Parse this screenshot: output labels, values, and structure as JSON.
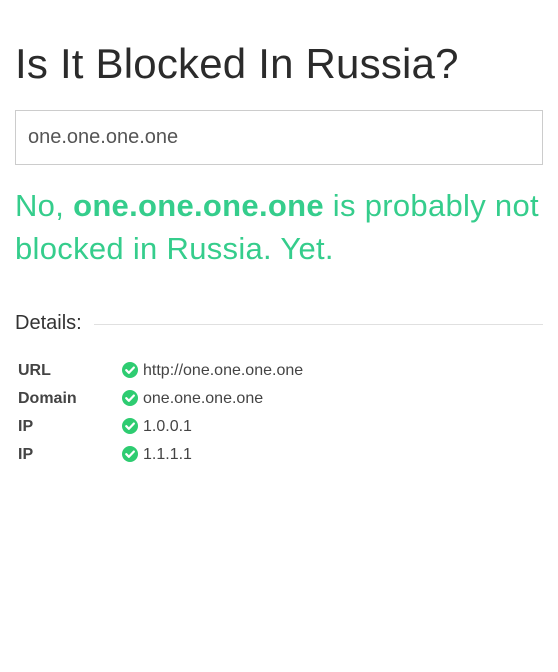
{
  "header": {
    "title": "Is It Blocked In Russia?"
  },
  "search": {
    "value": "one.one.one.one"
  },
  "result": {
    "prefix": "No,",
    "domain": "one.one.one.one",
    "suffix": "is probably not blocked in Russia. Yet.",
    "color": "#35cd8c"
  },
  "details": {
    "label": "Details:",
    "status_icon": "check-circle-icon",
    "status_color": "#2ecc71",
    "rows": [
      {
        "key": "URL",
        "value": "http://one.one.one.one"
      },
      {
        "key": "Domain",
        "value": "one.one.one.one"
      },
      {
        "key": "IP",
        "value": "1.0.0.1"
      },
      {
        "key": "IP",
        "value": "1.1.1.1"
      }
    ]
  }
}
